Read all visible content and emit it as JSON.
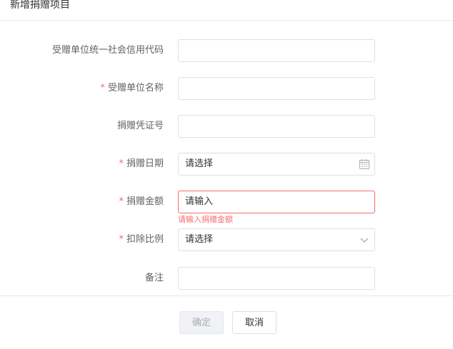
{
  "dialog": {
    "title": "新增捐赠项目",
    "fields": {
      "credit_code": {
        "label": "受赠单位统一社会信用代码",
        "required": false,
        "value": ""
      },
      "recipient_name": {
        "label": "受赠单位名称",
        "required": true,
        "value": ""
      },
      "voucher_no": {
        "label": "捐赠凭证号",
        "required": false,
        "value": ""
      },
      "donation_date": {
        "label": "捐赠日期",
        "required": true,
        "placeholder": "请选择",
        "icon": "calendar-icon"
      },
      "donation_amount": {
        "label": "捐赠金额",
        "required": true,
        "placeholder": "请输入",
        "error": "请输入捐赠金额"
      },
      "deduction_ratio": {
        "label": "扣除比例",
        "required": true,
        "placeholder": "请选择",
        "icon": "chevron-down-icon"
      },
      "remark": {
        "label": "备注",
        "required": false,
        "value": ""
      }
    },
    "required_mark": "*",
    "buttons": {
      "confirm": "确定",
      "cancel": "取消"
    },
    "colors": {
      "error": "#f56c6c",
      "border": "#dcdfe6",
      "label": "#606266"
    }
  }
}
